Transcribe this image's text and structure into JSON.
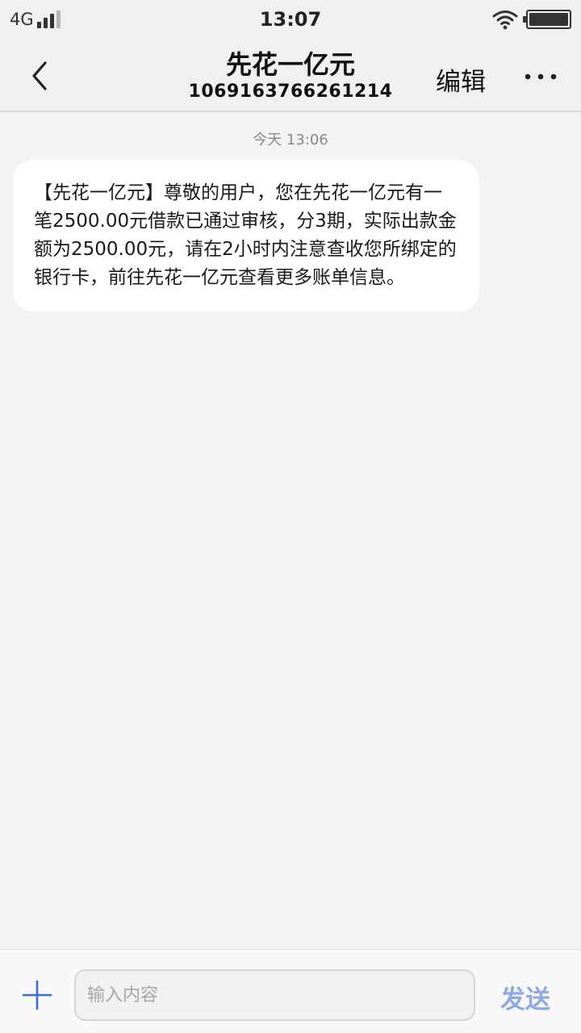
{
  "status_bar": {
    "network": "4G",
    "time": "13:07"
  },
  "header": {
    "back_icon": "chevron-left-icon",
    "title": "先花一亿元",
    "subtitle": "1069163766261214",
    "edit_label": "编辑",
    "more_icon": "more-horizontal-icon"
  },
  "conversation": {
    "timestamp": "今天 13:06",
    "messages": [
      {
        "text": "【先花一亿元】尊敬的用户，您在先花一亿元有一笔2500.00元借款已通过审核，分3期，实际出款金额为2500.00元，请在2小时内注意查收您所绑定的银行卡，前往先花一亿元查看更多账单信息。"
      }
    ]
  },
  "composer": {
    "add_icon": "plus-icon",
    "input_placeholder": "输入内容",
    "input_value": "",
    "send_label": "发送"
  },
  "colors": {
    "background": "#f3f3f3",
    "bubble": "#ffffff",
    "send_accent": "#8ea9e6",
    "add_icon": "#3d6ad6"
  }
}
